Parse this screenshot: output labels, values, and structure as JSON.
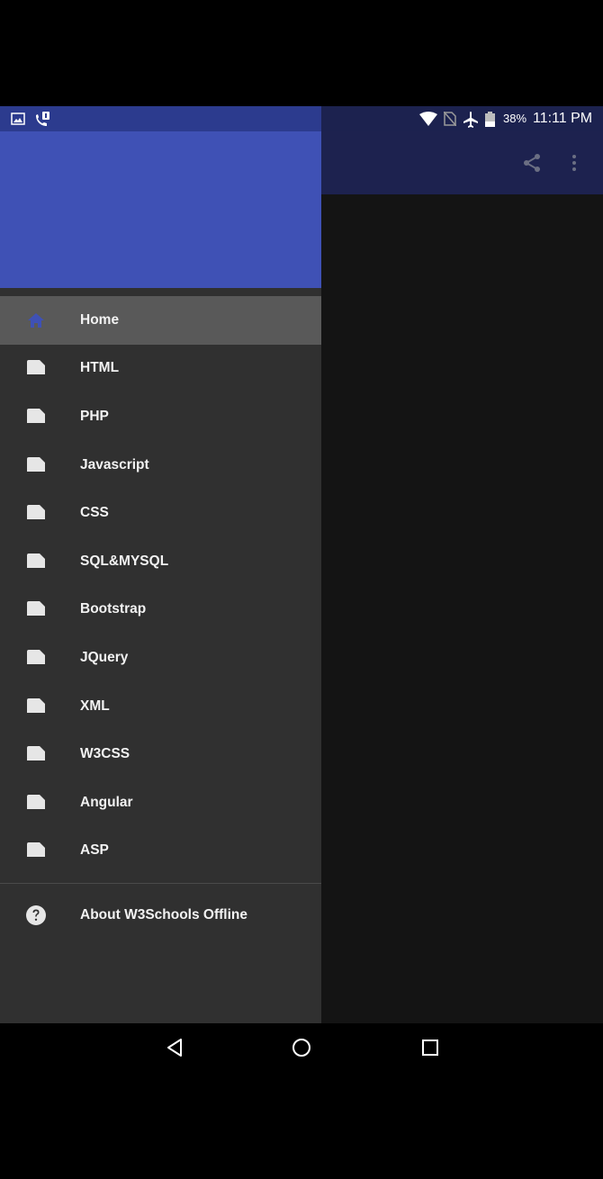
{
  "status_bar": {
    "battery_percent": "38%",
    "time": "11:11 PM",
    "icons_left": [
      "image-icon",
      "call-notification-icon"
    ],
    "icons_right": [
      "wifi-icon",
      "no-sim-icon",
      "airplane-mode-icon",
      "battery-icon"
    ]
  },
  "app_bar": {
    "actions": [
      "share-icon",
      "more-options-icon"
    ]
  },
  "drawer": {
    "header_color": "#3f51b5",
    "items": [
      {
        "label": "Home",
        "icon": "home-icon",
        "active": true
      },
      {
        "label": "HTML",
        "icon": "document-icon"
      },
      {
        "label": "PHP",
        "icon": "document-icon"
      },
      {
        "label": "Javascript",
        "icon": "document-icon"
      },
      {
        "label": "CSS",
        "icon": "document-icon"
      },
      {
        "label": "SQL&MYSQL",
        "icon": "document-icon"
      },
      {
        "label": "Bootstrap",
        "icon": "document-icon"
      },
      {
        "label": "JQuery",
        "icon": "document-icon"
      },
      {
        "label": "XML",
        "icon": "document-icon"
      },
      {
        "label": "W3CSS",
        "icon": "document-icon"
      },
      {
        "label": "Angular",
        "icon": "document-icon"
      },
      {
        "label": "ASP",
        "icon": "document-icon"
      }
    ],
    "about": {
      "label": "About W3Schools Offline",
      "icon": "help-icon"
    }
  },
  "nav_bar": {
    "buttons": [
      "back-icon",
      "home-circle-icon",
      "recents-icon"
    ]
  }
}
